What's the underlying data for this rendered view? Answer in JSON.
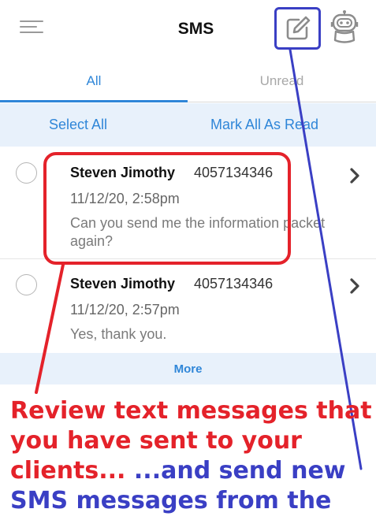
{
  "header": {
    "title": "SMS",
    "menu_icon": "menu-icon",
    "compose_icon": "compose-icon",
    "assistant_icon": "robot-icon"
  },
  "tabs": [
    {
      "label": "All",
      "active": true
    },
    {
      "label": "Unread",
      "active": false
    }
  ],
  "actions": {
    "select_all": "Select All",
    "mark_all_read": "Mark All As Read"
  },
  "messages": [
    {
      "sender": "Steven Jimothy",
      "phone": "4057134346",
      "date": "11/12/20, 2:58pm",
      "body": "Can you send me the information packet again?"
    },
    {
      "sender": "Steven Jimothy",
      "phone": "4057134346",
      "date": "11/12/20, 2:57pm",
      "body": "Yes, thank you."
    }
  ],
  "more_label": "More",
  "caption": {
    "red_text": "Review text messages that you have sent to your clients...",
    "blue_text": " ...and send new SMS messages from the app!"
  },
  "colors": {
    "accent": "#2f86d8",
    "annotation_red": "#e4222a",
    "annotation_blue": "#3a3fc4",
    "action_bar_bg": "#e8f1fb"
  }
}
